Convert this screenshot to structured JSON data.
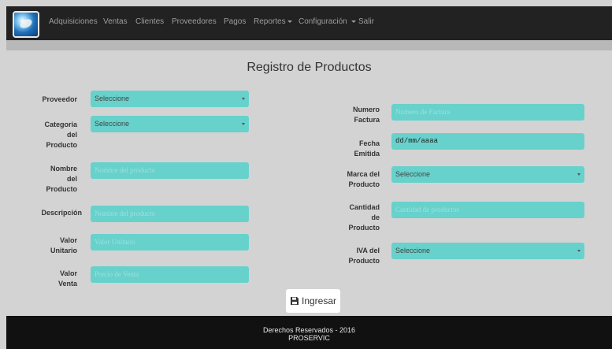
{
  "nav": {
    "items": [
      {
        "label": "Adquisiciones",
        "dropdown": false
      },
      {
        "label": "Ventas",
        "dropdown": false
      },
      {
        "label": "Clientes",
        "dropdown": false
      },
      {
        "label": "Proveedores",
        "dropdown": false
      },
      {
        "label": "Pagos",
        "dropdown": false
      },
      {
        "label": "Reportes",
        "dropdown": true
      },
      {
        "label": "Configuración",
        "dropdown": true
      },
      {
        "label": "Salir",
        "dropdown": false
      }
    ]
  },
  "page": {
    "title": "Registro de Productos"
  },
  "form": {
    "proveedor": {
      "label": "Proveedor",
      "value": "Seleccione"
    },
    "categoria": {
      "label": [
        "Categoria",
        "del",
        "Producto"
      ],
      "value": "Seleccione"
    },
    "nombre": {
      "label": [
        "Nombre",
        "del",
        "Producto"
      ],
      "placeholder": "Nombre del producto"
    },
    "descripcion": {
      "label": "Descripción",
      "placeholder": "Nombre del producto"
    },
    "valor_unitario": {
      "label": [
        "Valor",
        "Unitario"
      ],
      "placeholder": "Valor Unitario"
    },
    "valor_venta": {
      "label": [
        "Valor",
        "Venta"
      ],
      "placeholder": "Precio de Venta"
    },
    "numero_factura": {
      "label": [
        "Numero",
        "Factura"
      ],
      "placeholder": "Numero de Factura"
    },
    "fecha_emitida": {
      "label": [
        "Fecha",
        "Emitida"
      ],
      "value": "dd/mm/aaaa"
    },
    "marca": {
      "label": [
        "Marca del",
        "Producto"
      ],
      "value": "Seleccione"
    },
    "cantidad": {
      "label": [
        "Cantidad",
        "de",
        "Producto"
      ],
      "placeholder": "Cantidad de productos"
    },
    "iva": {
      "label": [
        "IVA del",
        "Producto"
      ],
      "value": "Seleccione"
    },
    "submit_label": "Ingresar"
  },
  "footer": {
    "line1": "Derechos Reservados - 2016",
    "line2": "PROSERVIC"
  },
  "colors": {
    "field_bg": "#67d1cc",
    "navbar_bg": "#222222",
    "footer_bg": "#111111",
    "page_bg": "#d3d3d3"
  },
  "icons": {
    "logo": "globe-logo-icon",
    "submit": "save-icon"
  }
}
